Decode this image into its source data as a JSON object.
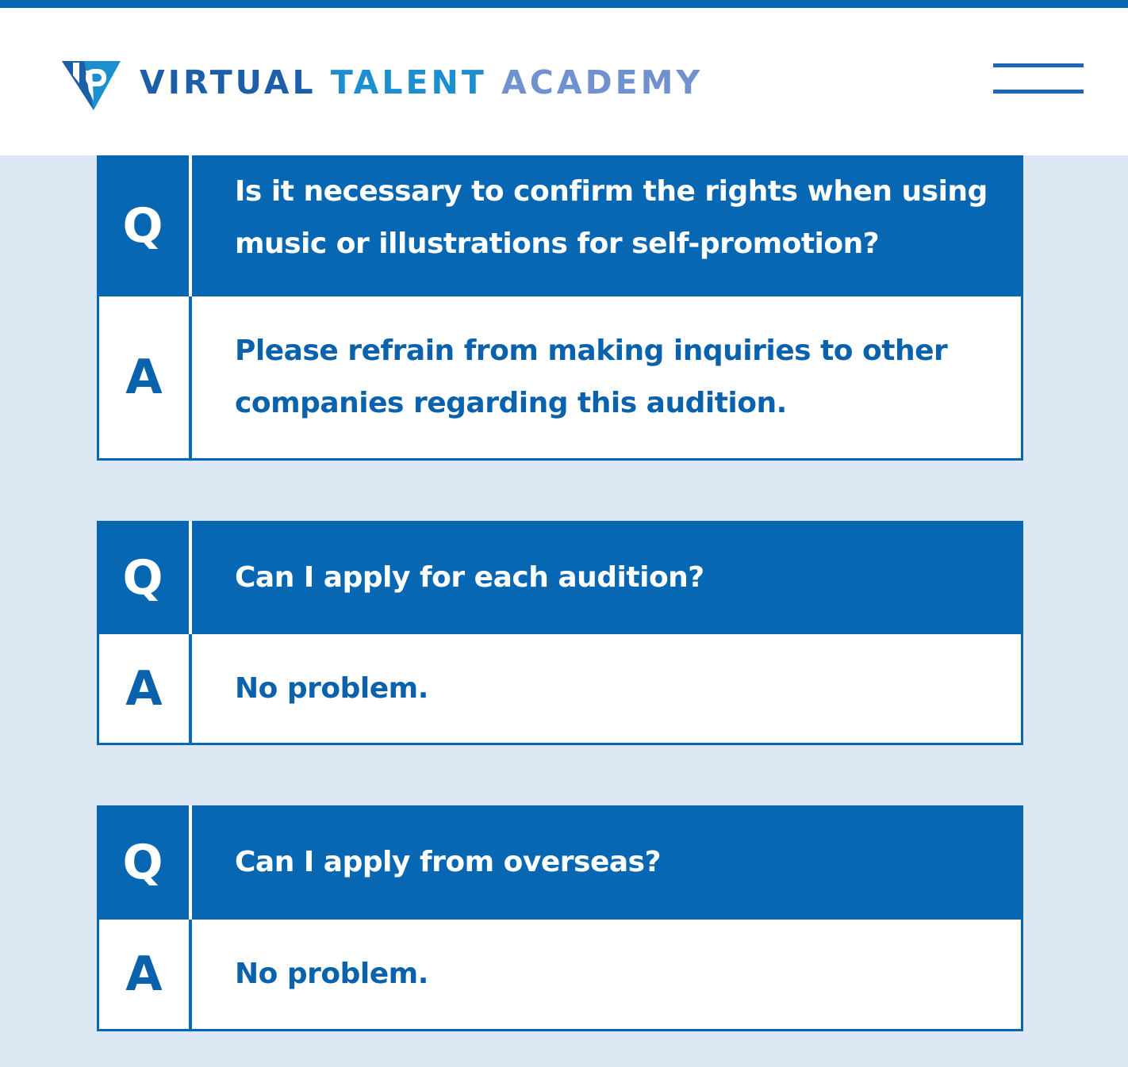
{
  "header": {
    "brand": {
      "word1": "VIRTUAL",
      "word2": "TALENT",
      "word3": "ACADEMY",
      "logo_icon": "vta-triangle-logo"
    },
    "menu_icon": "hamburger-menu-icon"
  },
  "faq": [
    {
      "q_mark": "Q",
      "question": "Is it necessary to confirm the rights when using music or illustrations for self-promotion?",
      "a_mark": "A",
      "answer": "Please refrain from making inquiries to other companies regarding this audition."
    },
    {
      "q_mark": "Q",
      "question": "Can I apply for each audition?",
      "a_mark": "A",
      "answer": "No problem."
    },
    {
      "q_mark": "Q",
      "question": "Can I apply from overseas?",
      "a_mark": "A",
      "answer": "No problem."
    }
  ],
  "colors": {
    "primary": "#0867b3",
    "background": "#dce9f5",
    "answer_text": "#0a62ac",
    "logo_virtual": "#1c5ea8",
    "logo_talent": "#1b8fd0",
    "logo_academy": "#6f91d0"
  }
}
